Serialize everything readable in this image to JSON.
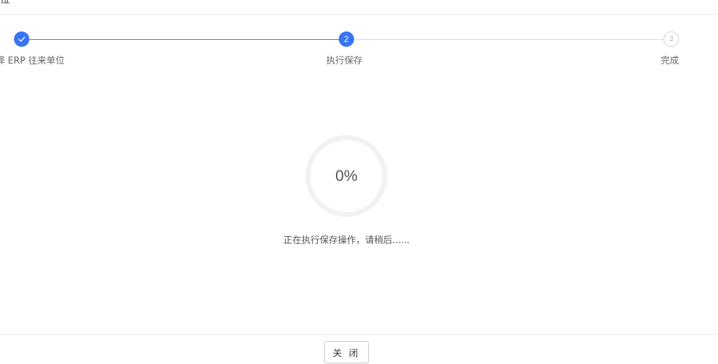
{
  "header": {
    "title": "位"
  },
  "steps": [
    {
      "label": "择 ERP 往来单位",
      "number": "1",
      "status": "done"
    },
    {
      "label": "执行保存",
      "number": "2",
      "status": "active"
    },
    {
      "label": "完成",
      "number": "3",
      "status": "pending"
    }
  ],
  "progress": {
    "percent": 0,
    "text": "0%"
  },
  "status_message": "正在执行保存操作，请稍后......",
  "footer": {
    "close_label": "关 闭"
  },
  "colors": {
    "primary": "#3a74f1",
    "ring_track": "#f2f2f2",
    "pending": "#cfcfcf"
  },
  "icons": {
    "done_step": "check-icon"
  }
}
